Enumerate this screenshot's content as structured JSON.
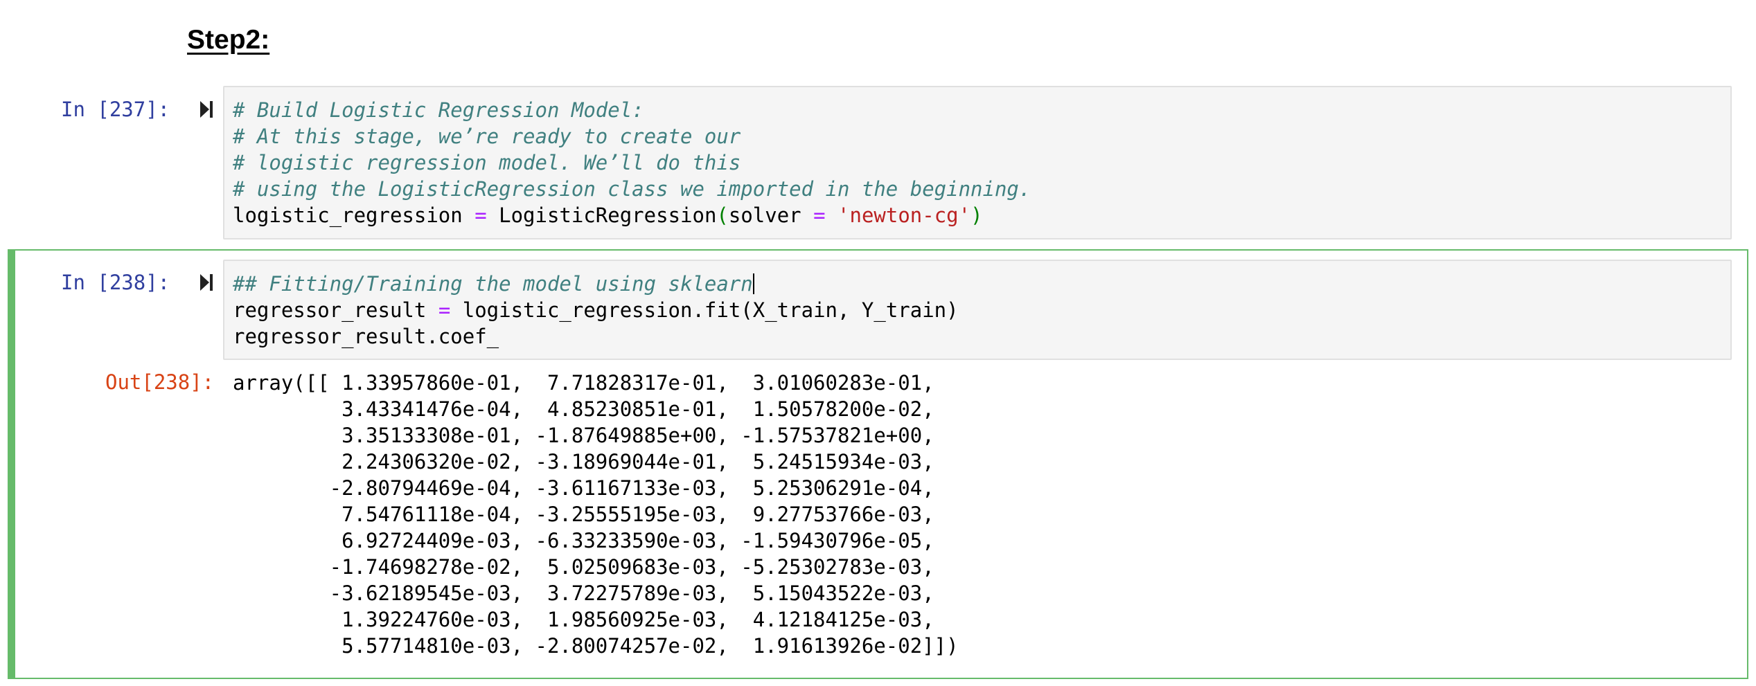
{
  "heading": "Step2:",
  "cells": [
    {
      "prompt": "In [237]:",
      "lines": [
        [
          {
            "t": "cm",
            "v": "# Build Logistic Regression Model:"
          }
        ],
        [
          {
            "t": "cm",
            "v": "# At this stage, we’re ready to create our"
          }
        ],
        [
          {
            "t": "cm",
            "v": "# logistic regression model. We’ll do this"
          }
        ],
        [
          {
            "t": "cm",
            "v": "# using the LogisticRegression class we imported in the beginning."
          }
        ],
        [
          {
            "t": "n",
            "v": "logistic_regression "
          },
          {
            "t": "op",
            "v": "="
          },
          {
            "t": "n",
            "v": " LogisticRegression"
          },
          {
            "t": "par",
            "v": "("
          },
          {
            "t": "n",
            "v": "solver "
          },
          {
            "t": "op",
            "v": "="
          },
          {
            "t": "n",
            "v": " "
          },
          {
            "t": "str",
            "v": "'newton-cg'"
          },
          {
            "t": "par",
            "v": ")"
          }
        ]
      ]
    },
    {
      "prompt": "In [238]:",
      "lines": [
        [
          {
            "t": "cm",
            "v": "## Fitting/Training the model using sklearn"
          },
          {
            "t": "cursor",
            "v": ""
          }
        ],
        [
          {
            "t": "n",
            "v": "regressor_result "
          },
          {
            "t": "op",
            "v": "="
          },
          {
            "t": "n",
            "v": " logistic_regression.fit(X_train, Y_train)"
          }
        ],
        [
          {
            "t": "n",
            "v": "regressor_result.coef_"
          }
        ]
      ]
    }
  ],
  "output": {
    "prompt": "Out[238]:",
    "lines": [
      "array([[ 1.33957860e-01,  7.71828317e-01,  3.01060283e-01,",
      "         3.43341476e-04,  4.85230851e-01,  1.50578200e-02,",
      "         3.35133308e-01, -1.87649885e+00, -1.57537821e+00,",
      "         2.24306320e-02, -3.18969044e-01,  5.24515934e-03,",
      "        -2.80794469e-04, -3.61167133e-03,  5.25306291e-04,",
      "         7.54761118e-04, -3.25555195e-03,  9.27753766e-03,",
      "         6.92724409e-03, -6.33233590e-03, -1.59430796e-05,",
      "        -1.74698278e-02,  5.02509683e-03, -5.25302783e-03,",
      "        -3.62189545e-03,  3.72275789e-03,  5.15043522e-03,",
      "         1.39224760e-03,  1.98560925e-03,  4.12184125e-03,",
      "         5.57714810e-03, -2.80074257e-02,  1.91613926e-02]])"
    ]
  }
}
